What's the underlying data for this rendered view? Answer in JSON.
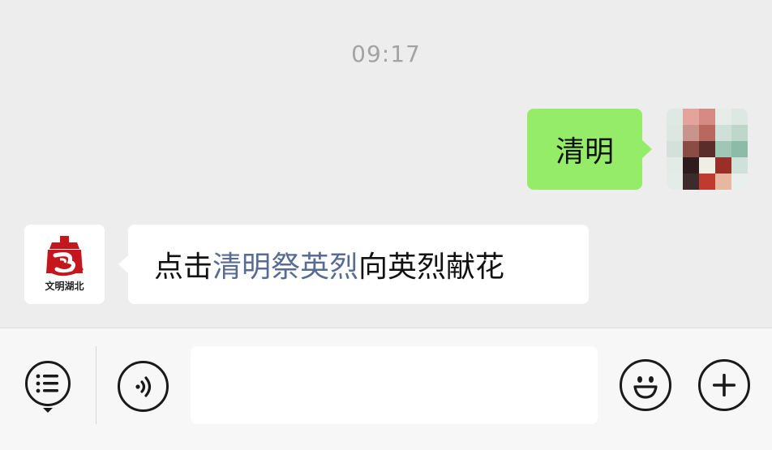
{
  "chat": {
    "timestamp": "09:17",
    "outgoing_message": "清明",
    "incoming_message": {
      "prefix": "点击",
      "link": "清明祭英烈",
      "suffix": "向英烈献花"
    },
    "sender_logo_text": "文明湖北"
  },
  "input_bar": {
    "text_value": "",
    "icons": [
      "menu-icon",
      "voice-icon",
      "emoji-icon",
      "plus-icon"
    ]
  },
  "colors": {
    "outgoing_bubble": "#95ec69",
    "link": "#576b95",
    "logo_red": "#c4161c"
  }
}
